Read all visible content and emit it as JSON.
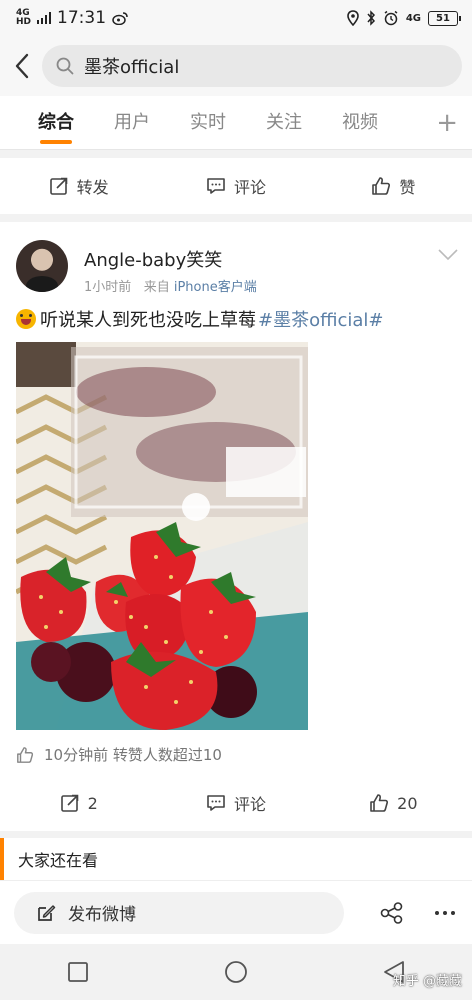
{
  "status_bar": {
    "network_top": "4G",
    "network_bottom": "HD",
    "time": "17:31",
    "network2": "4G",
    "battery": "51"
  },
  "search": {
    "query": "墨茶official"
  },
  "tabs": [
    {
      "label": "综合",
      "active": true
    },
    {
      "label": "用户"
    },
    {
      "label": "实时"
    },
    {
      "label": "关注"
    },
    {
      "label": "视频"
    }
  ],
  "tabs_more": "+",
  "prev_post_actions": {
    "repost_label": "转发",
    "comment_label": "评论",
    "like_label": "赞"
  },
  "post": {
    "username": "Angle-baby笑笑",
    "time": "1小时前",
    "source_prefix": "来自",
    "source": "iPhone客户端",
    "text": "听说某人到死也没吃上草莓",
    "hashtag": "#墨茶official#",
    "repost_info": "10分钟前 转赞人数超过10",
    "actions": {
      "repost_count": "2",
      "comment_label": "评论",
      "like_count": "20"
    }
  },
  "also_watching": "大家还在看",
  "compose": {
    "label": "发布微博"
  },
  "watermark": "知乎 @藏藏",
  "colors": {
    "accent": "#ff8200",
    "link": "#5b7fa6"
  }
}
